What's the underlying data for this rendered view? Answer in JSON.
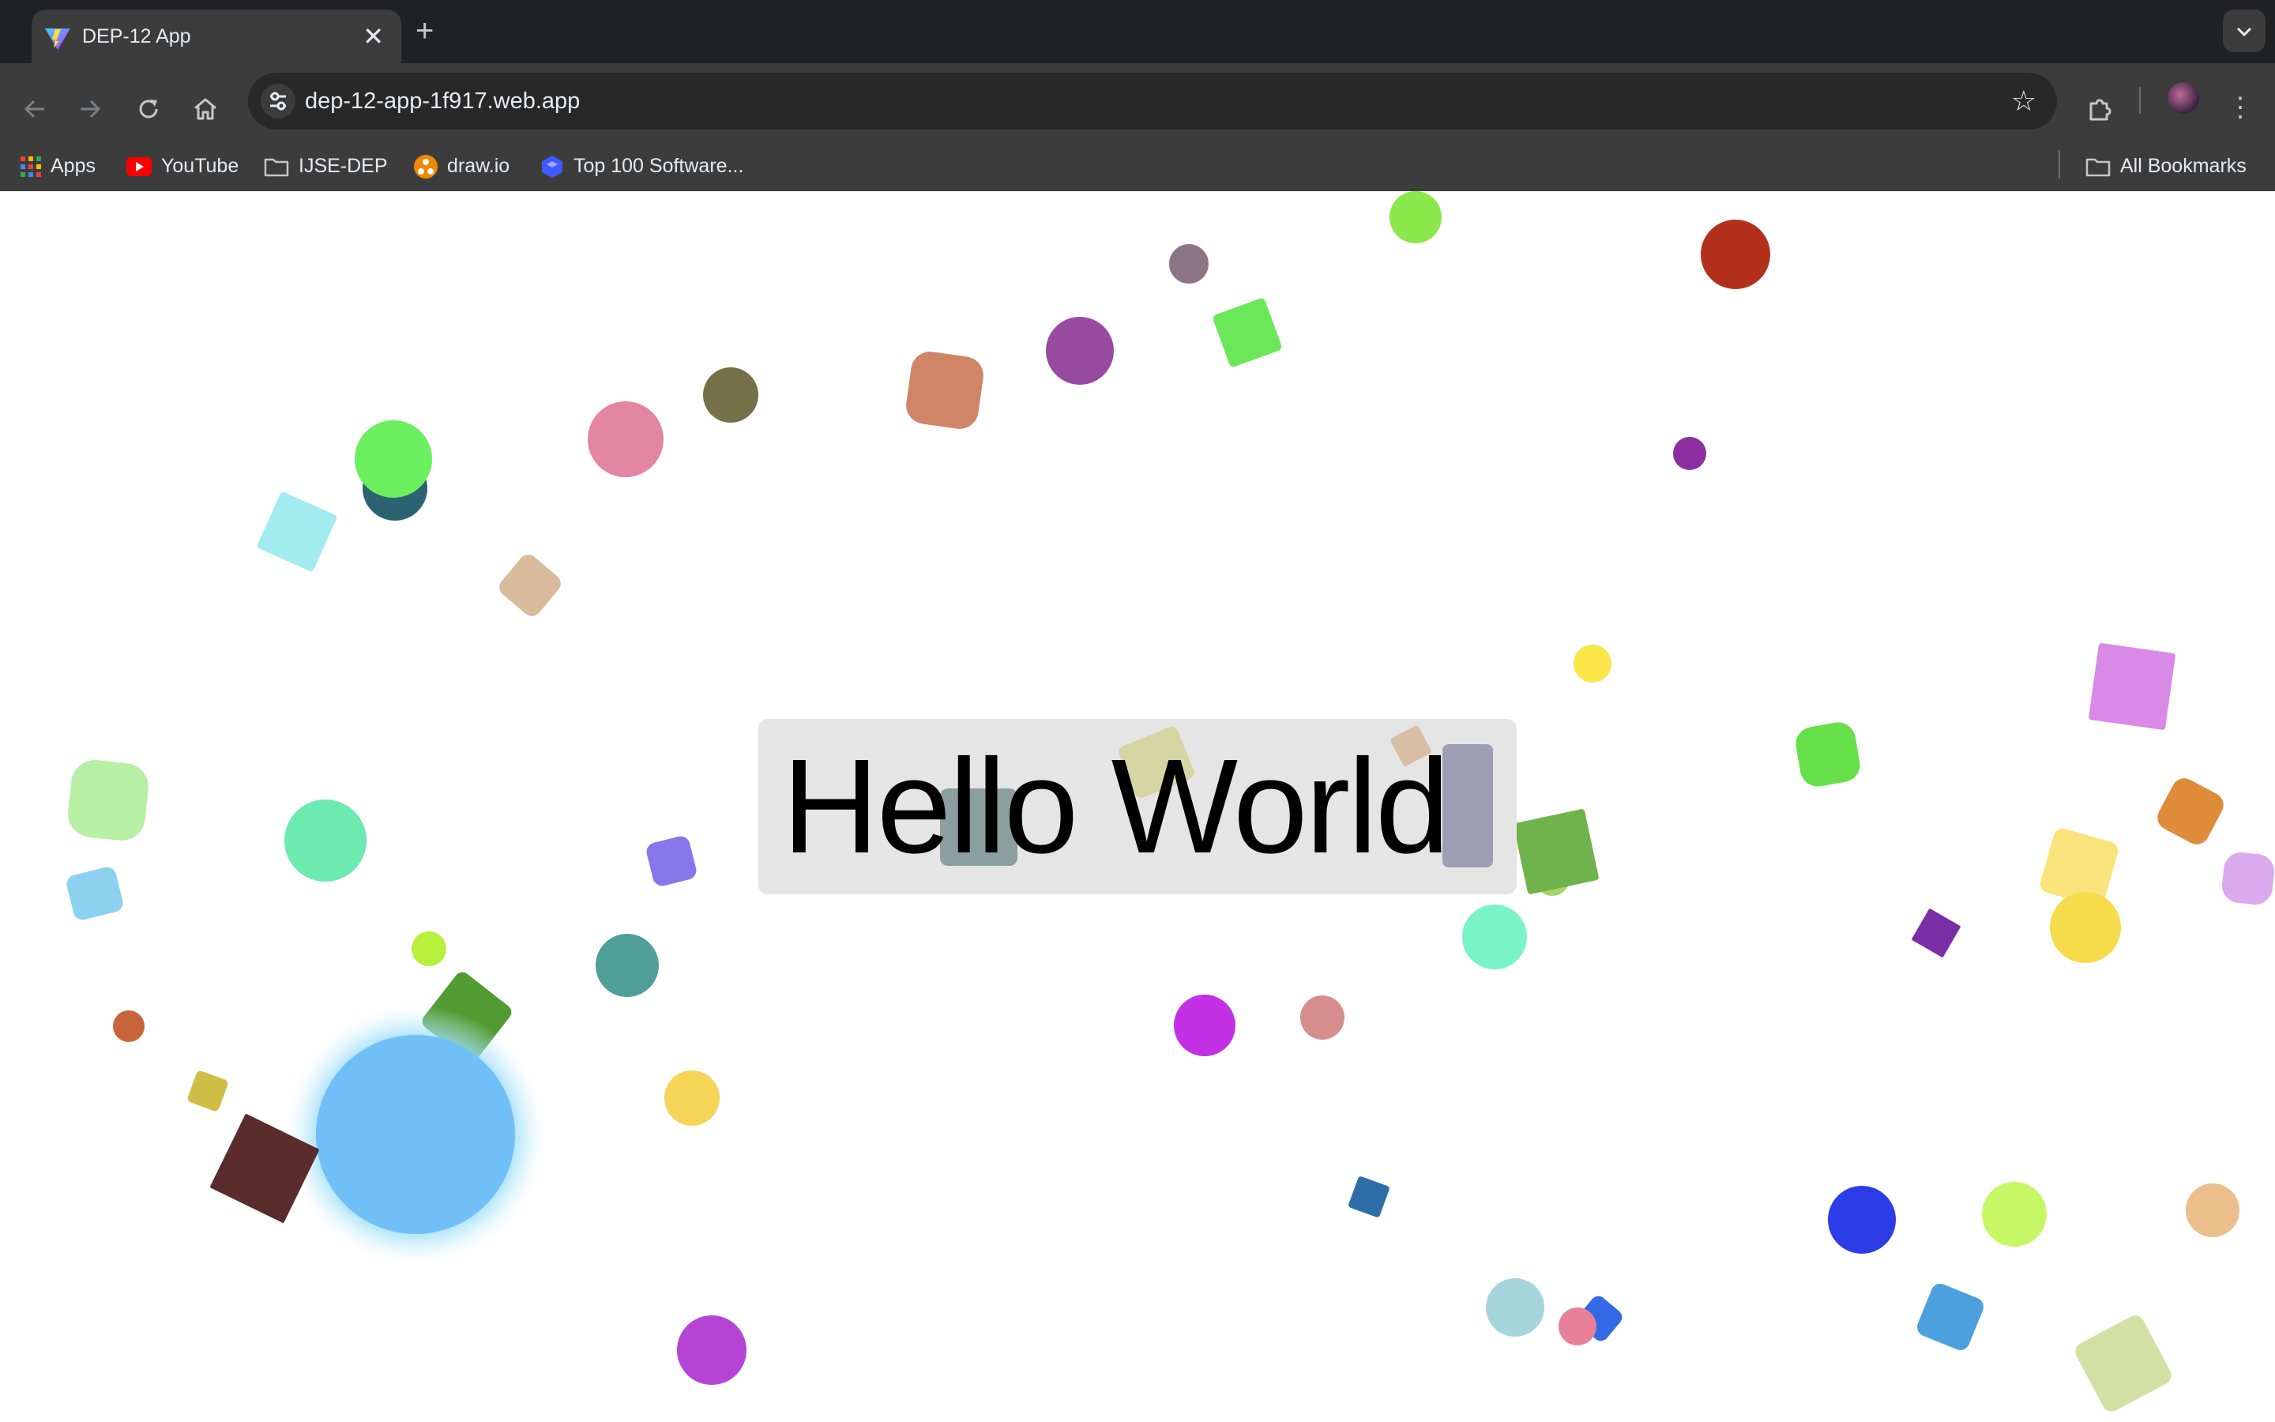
{
  "browser": {
    "tab_title": "DEP-12 App",
    "tab_close": "✕",
    "new_tab": "+",
    "tab_search_icon": "chevron-down",
    "url": "dep-12-app-1f917.web.app",
    "nav": {
      "back": "←",
      "forward": "→",
      "reload": "⟳",
      "home": "⌂"
    },
    "star": "☆",
    "menu": "⋮",
    "extensions": "⧉"
  },
  "bookmarks": {
    "items": [
      {
        "label": "Apps",
        "icon": "apps-grid-icon"
      },
      {
        "label": "YouTube",
        "icon": "youtube-icon"
      },
      {
        "label": "IJSE-DEP",
        "icon": "folder-icon"
      },
      {
        "label": "draw.io",
        "icon": "drawio-icon"
      },
      {
        "label": "Top 100 Software...",
        "icon": "bookmark-site-icon"
      }
    ],
    "all_bookmarks": "All Bookmarks"
  },
  "page": {
    "heading": "Hello World"
  },
  "colors": {
    "chrome_dark": "#202124",
    "chrome_toolbar": "#3c3c3c",
    "omnibox": "#282828",
    "page_bg": "#ffffff",
    "hello_box": "#e5e5e5"
  }
}
